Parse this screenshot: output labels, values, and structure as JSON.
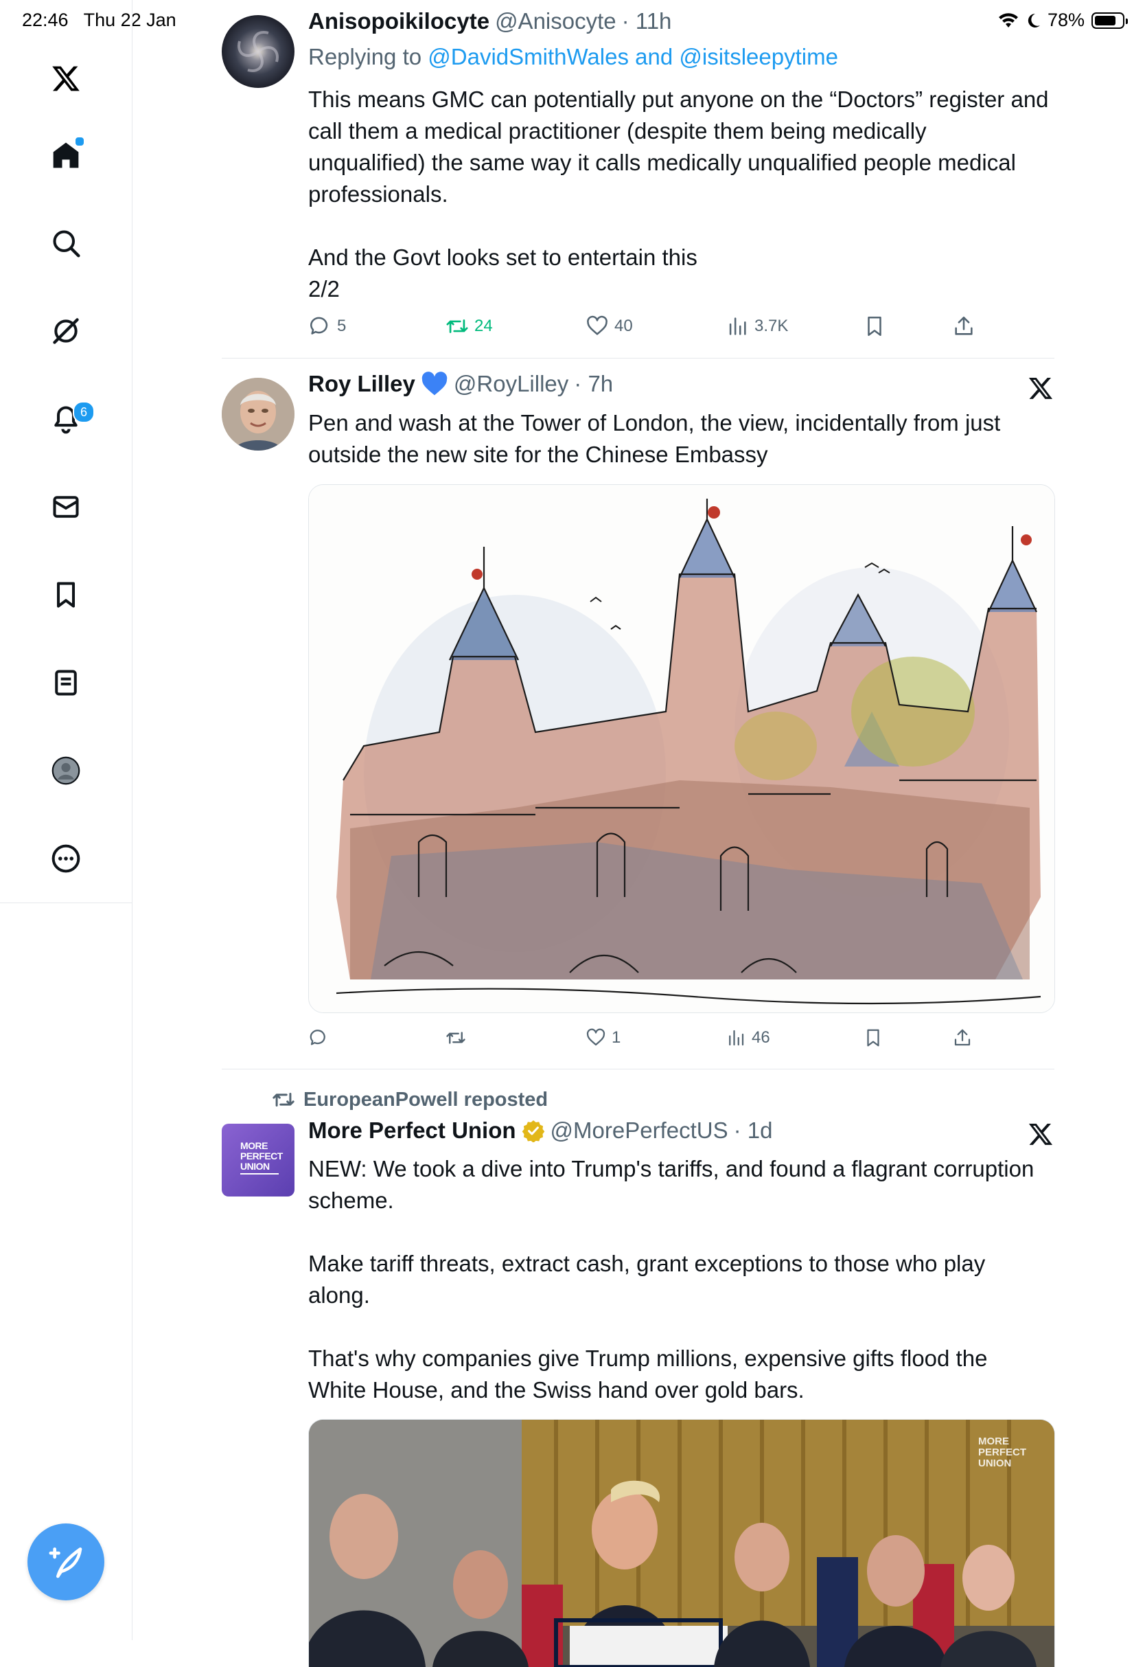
{
  "status_bar": {
    "time": "22:46",
    "date": "Thu 22 Jan",
    "battery": "78%"
  },
  "sidebar": {
    "items": [
      {
        "name": "x-logo-icon"
      },
      {
        "name": "home-icon"
      },
      {
        "name": "search-icon"
      },
      {
        "name": "grok-icon"
      },
      {
        "name": "bell-icon",
        "badge": "6"
      },
      {
        "name": "mail-icon"
      },
      {
        "name": "bookmark-icon"
      },
      {
        "name": "list-icon"
      },
      {
        "name": "profile-icon"
      },
      {
        "name": "more-icon"
      }
    ],
    "compose_icon": "compose-icon"
  },
  "tweets": [
    {
      "name": "Anisopoikilocyte",
      "handle": "@Anisocyte",
      "time": "· 11h",
      "replying_prefix": "Replying to",
      "replying_to": "@DavidSmithWales and @isitsleepytime",
      "text": "This means GMC can potentially put anyone on the “Doctors” register and call them a medical practitioner (despite them being medically unqualified) the same way it calls medically unqualified people medical professionals.\n\nAnd the Govt looks set to entertain this\n2/2",
      "replies": "5",
      "reposts": "24",
      "likes": "40",
      "views": "3.7K"
    },
    {
      "name": "Roy Lilley",
      "handle": "@RoyLilley",
      "time": "· 7h",
      "text": "Pen and wash at the Tower of London, the view, incidentally from just outside the new site for the Chinese Embassy",
      "replies": "",
      "reposts": "",
      "likes": "1",
      "views": "46"
    },
    {
      "repost_by": "EuropeanPowell reposted",
      "name": "More Perfect Union",
      "handle": "@MorePerfectUS",
      "time": "· 1d",
      "avatar_text": "MORE\nPERFECT\nUNION",
      "text": "NEW: We took a dive into Trump's tariffs, and found a flagrant corruption scheme.\n\nMake tariff threats, extract cash, grant exceptions to those who play along.\n\nThat's why companies give Trump millions, expensive gifts flood the White House, and the Swiss hand over gold bars.",
      "watermark": "MORE\nPERFECT\nUNION"
    }
  ],
  "colors": {
    "accent": "#1d9bf0",
    "repost_green": "#00ba7c",
    "muted": "#536471"
  }
}
